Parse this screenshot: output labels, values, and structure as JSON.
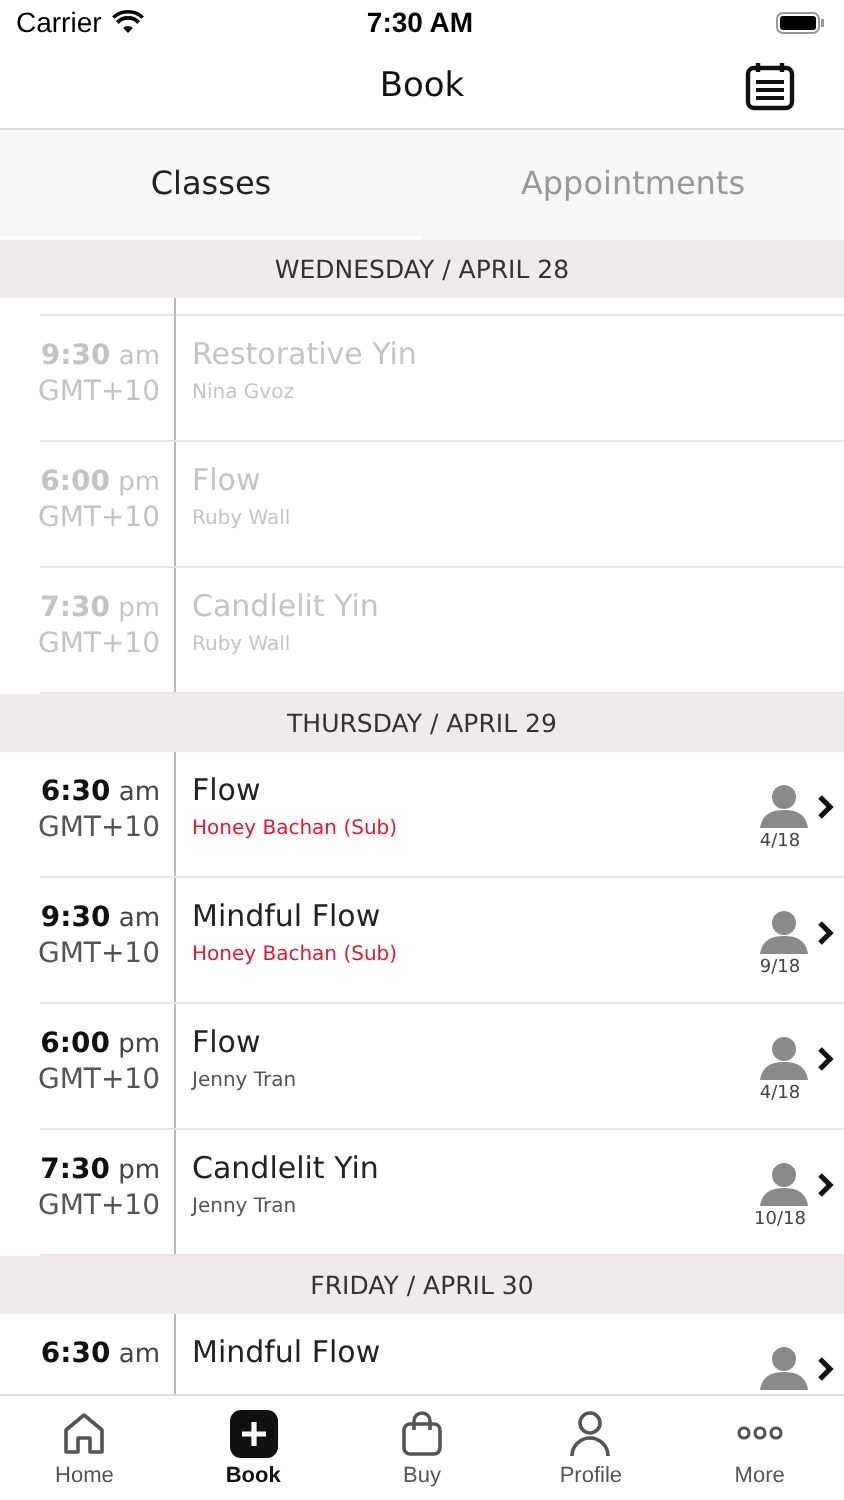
{
  "status_bar": {
    "carrier": "Carrier",
    "time": "7:30 AM"
  },
  "nav": {
    "title": "Book"
  },
  "tabs": [
    {
      "label": "Classes",
      "selected": true
    },
    {
      "label": "Appointments",
      "selected": false
    }
  ],
  "days": [
    {
      "header": "WEDNESDAY / APRIL 28",
      "classes": [
        {
          "time": "9:30",
          "ampm": "am",
          "zone": "GMT+10",
          "title": "Restorative Yin",
          "instructor": "Nina Gvoz",
          "past": true
        },
        {
          "time": "6:00",
          "ampm": "pm",
          "zone": "GMT+10",
          "title": "Flow",
          "instructor": "Ruby Wall",
          "past": true
        },
        {
          "time": "7:30",
          "ampm": "pm",
          "zone": "GMT+10",
          "title": "Candlelit Yin",
          "instructor": "Ruby Wall",
          "past": true
        }
      ]
    },
    {
      "header": "THURSDAY / APRIL 29",
      "classes": [
        {
          "time": "6:30",
          "ampm": "am",
          "zone": "GMT+10",
          "title": "Flow",
          "instructor": "Honey Bachan (Sub)",
          "past": false,
          "substitute": true,
          "spots": "4/18"
        },
        {
          "time": "9:30",
          "ampm": "am",
          "zone": "GMT+10",
          "title": "Mindful Flow",
          "instructor": "Honey Bachan (Sub)",
          "past": false,
          "substitute": true,
          "spots": "9/18"
        },
        {
          "time": "6:00",
          "ampm": "pm",
          "zone": "GMT+10",
          "title": "Flow",
          "instructor": "Jenny Tran",
          "past": false,
          "substitute": false,
          "spots": "4/18"
        },
        {
          "time": "7:30",
          "ampm": "pm",
          "zone": "GMT+10",
          "title": "Candlelit Yin",
          "instructor": "Jenny Tran",
          "past": false,
          "substitute": false,
          "spots": "10/18"
        }
      ]
    },
    {
      "header": "FRIDAY / APRIL 30",
      "classes": [
        {
          "time": "6:30",
          "ampm": "am",
          "title": "Mindful Flow",
          "past": false
        }
      ]
    }
  ],
  "tab_bar": [
    {
      "label": "Home",
      "kind": "home",
      "selected": false
    },
    {
      "label": "Book",
      "kind": "book",
      "selected": true
    },
    {
      "label": "Buy",
      "kind": "buy",
      "selected": false
    },
    {
      "label": "Profile",
      "kind": "profile",
      "selected": false
    },
    {
      "label": "More",
      "kind": "more",
      "selected": false
    }
  ]
}
